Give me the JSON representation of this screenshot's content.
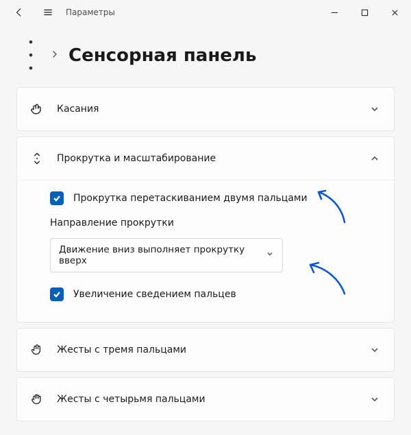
{
  "app": {
    "title": "Параметры"
  },
  "breadcrumb": {
    "page_title": "Сенсорная панель"
  },
  "sections": {
    "taps": {
      "label": "Касания"
    },
    "scroll_zoom": {
      "label": "Прокрутка и масштабирование",
      "two_finger_scroll": "Прокрутка перетаскиванием двумя пальцами",
      "direction_label": "Направление прокрутки",
      "direction_value": "Движение вниз выполняет прокрутку вверх",
      "pinch_zoom": "Увеличение сведением пальцев"
    },
    "three_finger": {
      "label": "Жесты с тремя пальцами"
    },
    "four_finger": {
      "label": "Жесты с четырьмя пальцами"
    }
  }
}
